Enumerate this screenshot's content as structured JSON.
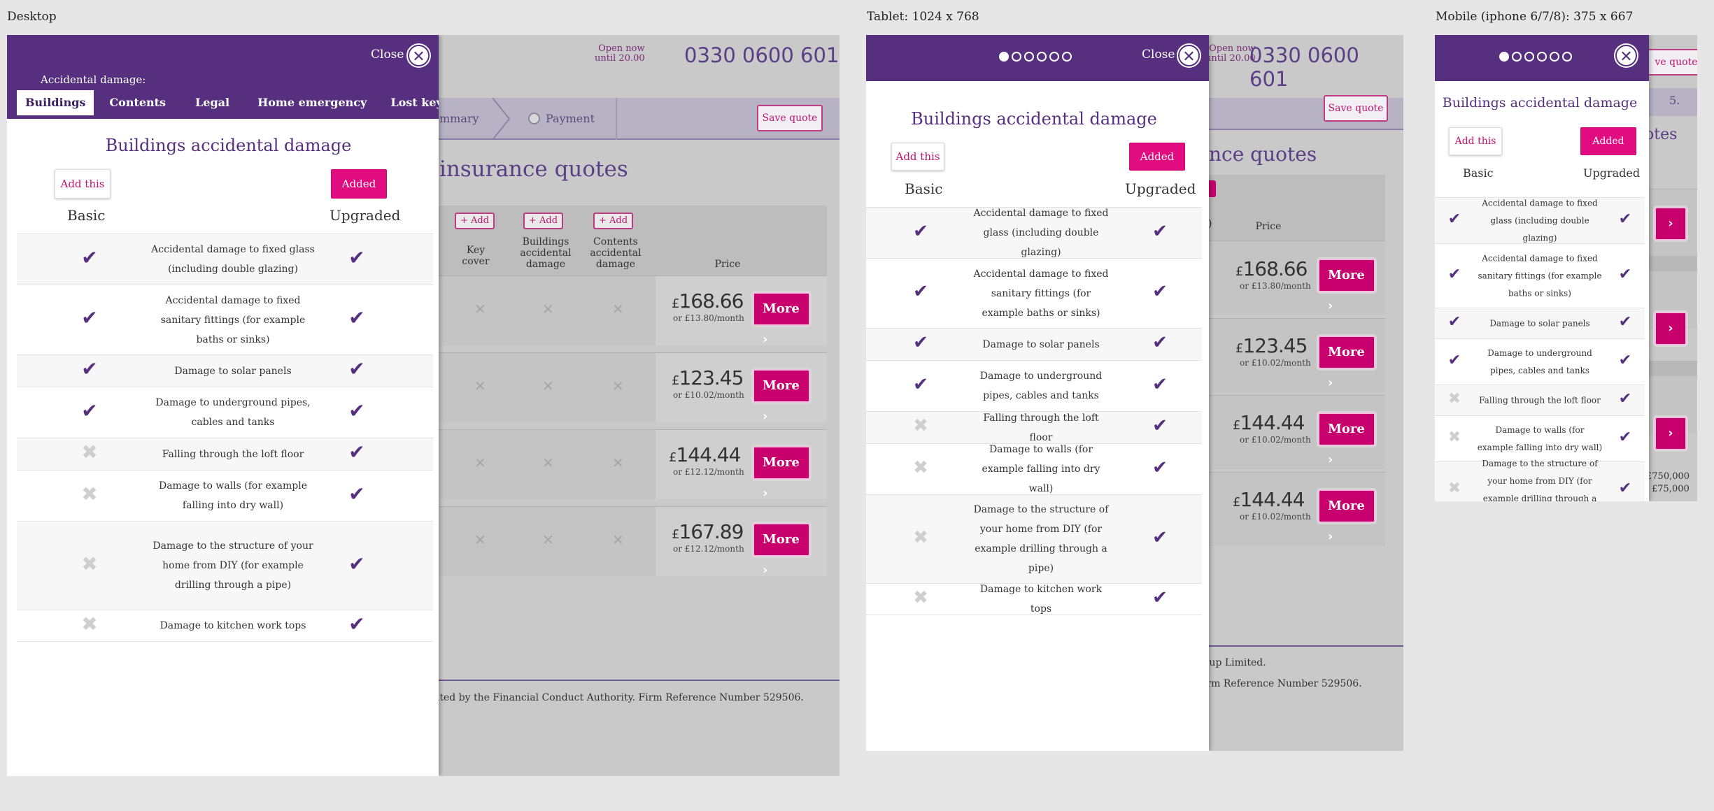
{
  "labels": {
    "desktop": "Desktop",
    "tablet": "Tablet: 1024 x 768",
    "mobile": "Mobile (iphone 6/7/8): 375 x 667"
  },
  "background_page": {
    "open_now": "Open now",
    "until": "until 20.00",
    "phone": "0330 0600 601",
    "steps": [
      "mmary",
      "Payment"
    ],
    "tablet_step": "5.",
    "save_quote": "Save quote",
    "save_quote_partial": "ve quote",
    "title": "insurance quotes",
    "tablet_title": "nce quotes",
    "mobile_title": "otes",
    "add_label": "+ Add",
    "columns": [
      "Key cover",
      "Buildings accidental damage",
      "Contents accidental damage",
      "Price"
    ],
    "tablet_partial_col": "s d)",
    "quotes": [
      {
        "price": "168.66",
        "monthly": "or £13.80/month"
      },
      {
        "price": "123.45",
        "monthly": "or £10.02/month"
      },
      {
        "price": "144.44",
        "monthly": "or £12.12/month"
      },
      {
        "price": "167.89",
        "monthly": "or £12.12/month"
      }
    ],
    "tablet_quotes": [
      {
        "price": "168.66",
        "monthly": "or £13.80/month"
      },
      {
        "price": "123.45",
        "monthly": "or £10.02/month"
      },
      {
        "price": "144.44",
        "monthly": "or £10.02/month"
      },
      {
        "price": "144.44",
        "monthly": "or £10.02/month"
      }
    ],
    "currency": "£",
    "more": "More",
    "footer_fca": "ated by the Financial Conduct Authority. Firm Reference Number 529506.",
    "footer_group": "oup Limited.",
    "footer_ref": "irm Reference Number 529506.",
    "mobile_amounts": [
      "750,000",
      "75,000"
    ],
    "mobile_currency": "£"
  },
  "modal": {
    "close": "Close",
    "subtitle": "Accidental damage:",
    "tabs": [
      "Buildings",
      "Contents",
      "Legal",
      "Home emergency",
      "Lost keys"
    ],
    "active_tab": "Buildings",
    "title": "Buildings accidental damage",
    "add_this": "Add this",
    "added": "Added",
    "basic": "Basic",
    "upgraded": "Upgraded",
    "features": [
      {
        "text": "Accidental damage to fixed glass (including double glazing)",
        "basic": true,
        "upgraded": true
      },
      {
        "text": "Accidental damage to fixed sanitary fittings (for example baths or sinks)",
        "basic": true,
        "upgraded": true
      },
      {
        "text": "Damage to solar panels",
        "basic": true,
        "upgraded": true
      },
      {
        "text": "Damage to underground pipes, cables and tanks",
        "basic": true,
        "upgraded": true
      },
      {
        "text": "Falling through the loft floor",
        "basic": false,
        "upgraded": true
      },
      {
        "text": "Damage to walls (for example falling into dry wall)",
        "basic": false,
        "upgraded": true
      },
      {
        "text": "Damage to the structure of your home from DIY (for example drilling through a pipe)",
        "basic": false,
        "upgraded": true
      },
      {
        "text": "Damage to kitchen work tops",
        "basic": false,
        "upgraded": true
      }
    ],
    "mobile_partial_feature": "Damage to the structure of your home from DIY (for",
    "pager_count": 6,
    "pager_active": 1
  },
  "colors": {
    "purple": "#56307e",
    "pink": "#e10c7f",
    "grey_bg": "#c9c9c9"
  },
  "icons": {
    "tick": "check-icon",
    "cross": "cross-icon",
    "close": "close-icon",
    "more": "chevron-right-icon"
  }
}
